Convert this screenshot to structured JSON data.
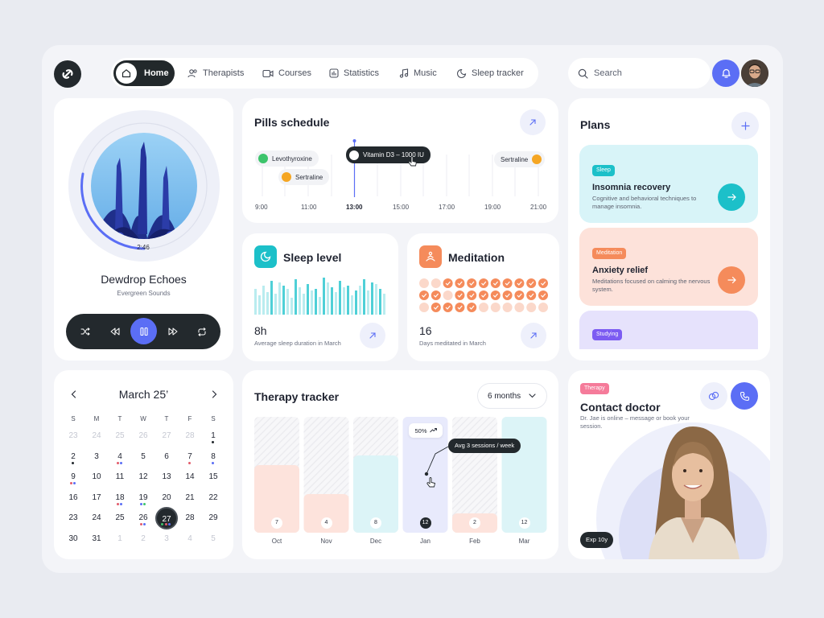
{
  "nav": {
    "home": "Home",
    "items": [
      "Therapists",
      "Courses",
      "Statistics",
      "Music",
      "Sleep tracker"
    ],
    "search_placeholder": "Search"
  },
  "player": {
    "time": "2:46",
    "title": "Dewdrop Echoes",
    "artist": "Evergreen Sounds",
    "progress": 0.38
  },
  "pills": {
    "title": "Pills schedule",
    "times": [
      "9:00",
      "11:00",
      "13:00",
      "15:00",
      "17:00",
      "19:00",
      "21:00"
    ],
    "current_time": "13:00",
    "items": {
      "levothyroxine": "Levothyroxine",
      "sertraline_1": "Sertraline",
      "vitamin": "Vitamin D3 – 1000 IU",
      "sertraline_2": "Sertraline"
    }
  },
  "sleep": {
    "title": "Sleep level",
    "value": "8h",
    "caption": "Average sleep duration in March"
  },
  "meditation": {
    "title": "Meditation",
    "value": "16",
    "caption": "Days meditated in March"
  },
  "plans": {
    "title": "Plans",
    "items": [
      {
        "tag": "Sleep",
        "title": "Insomnia recovery",
        "desc": "Cognitive and behavioral techniques to manage insomnia."
      },
      {
        "tag": "Meditation",
        "title": "Anxiety relief",
        "desc": "Meditations focused on calming the nervous system."
      },
      {
        "tag": "Studying"
      }
    ]
  },
  "calendar": {
    "month": "March 25’",
    "weekdays": [
      "S",
      "M",
      "T",
      "W",
      "T",
      "F",
      "S"
    ],
    "weeks": [
      [
        "23",
        "24",
        "25",
        "26",
        "27",
        "28",
        "1"
      ],
      [
        "2",
        "3",
        "4",
        "5",
        "6",
        "7",
        "8"
      ],
      [
        "9",
        "10",
        "11",
        "12",
        "13",
        "14",
        "15"
      ],
      [
        "16",
        "17",
        "18",
        "19",
        "20",
        "21",
        "22"
      ],
      [
        "23",
        "24",
        "25",
        "26",
        "27",
        "28",
        "29"
      ],
      [
        "30",
        "31",
        "1",
        "2",
        "3",
        "4",
        "5"
      ]
    ],
    "selected": "27"
  },
  "therapy": {
    "title": "Therapy tracker",
    "range": "6 months",
    "tooltip_pct": "50%",
    "tooltip_avg": "Avg 3 sessions / week",
    "months": [
      "Oct",
      "Nov",
      "Dec",
      "Jan",
      "Feb",
      "Mar"
    ],
    "sessions": [
      "7",
      "4",
      "8",
      "12",
      "2",
      "12"
    ]
  },
  "doctor": {
    "tag": "Therapy",
    "title": "Contact doctor",
    "desc": "Dr. Jae is online – message or book your session.",
    "exp": "Exp 10y"
  },
  "colors": {
    "accent": "#5b6ef5",
    "dark": "#23292d",
    "teal": "#1cc0c9",
    "orange": "#f58b5b",
    "purple": "#7c5cf2"
  }
}
